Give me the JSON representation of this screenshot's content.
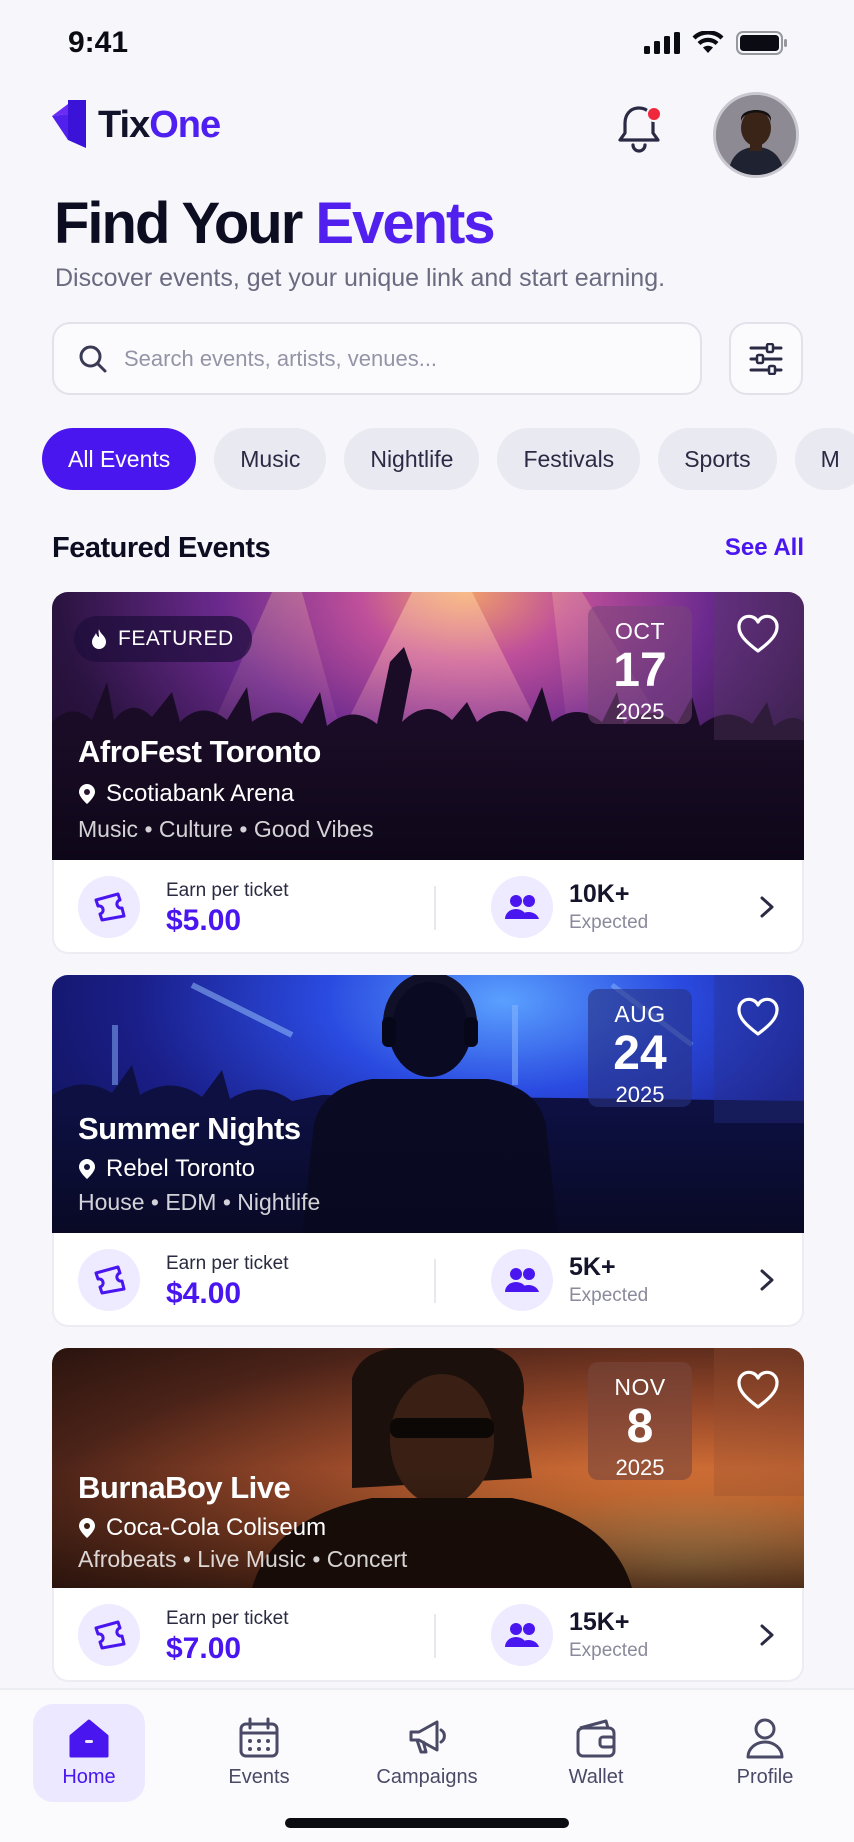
{
  "status_bar": {
    "time": "9:41"
  },
  "header": {
    "logo_part1": "Tix",
    "logo_part2": "One",
    "notification_icon": "bell-icon",
    "has_notification": true
  },
  "hero": {
    "title_part1": "Find Your ",
    "title_part2": "Events",
    "subtitle": "Discover events, get your unique link and start earning."
  },
  "search": {
    "placeholder": "Search events, artists, venues..."
  },
  "categories": [
    {
      "label": "All Events",
      "active": true
    },
    {
      "label": "Music",
      "active": false
    },
    {
      "label": "Nightlife",
      "active": false
    },
    {
      "label": "Festivals",
      "active": false
    },
    {
      "label": "Sports",
      "active": false
    },
    {
      "label": "M",
      "active": false
    }
  ],
  "featured": {
    "title": "Featured Events",
    "see_all": "See All",
    "earn_label": "Earn per ticket",
    "expected_label": "Expected",
    "badge": "FEATURED",
    "events": [
      {
        "name": "AfroFest Toronto",
        "venue": "Scotiabank Arena",
        "tags": "Music • Culture • Good Vibes",
        "month": "OCT",
        "day": "17",
        "year": "2025",
        "earn": "$5.00",
        "expected": "10K+",
        "featured": true
      },
      {
        "name": "Summer Nights",
        "venue": "Rebel Toronto",
        "tags": "House • EDM • Nightlife",
        "month": "AUG",
        "day": "24",
        "year": "2025",
        "earn": "$4.00",
        "expected": "5K+",
        "featured": false
      },
      {
        "name": "BurnaBoy Live",
        "venue": "Coca-Cola Coliseum",
        "tags": "Afrobeats • Live Music • Concert",
        "month": "NOV",
        "day": "8",
        "year": "2025",
        "earn": "$7.00",
        "expected": "15K+",
        "featured": false
      }
    ]
  },
  "tabbar": [
    {
      "label": "Home",
      "icon": "home-icon",
      "active": true
    },
    {
      "label": "Events",
      "icon": "calendar-icon",
      "active": false
    },
    {
      "label": "Campaigns",
      "icon": "megaphone-icon",
      "active": false
    },
    {
      "label": "Wallet",
      "icon": "wallet-icon",
      "active": false
    },
    {
      "label": "Profile",
      "icon": "user-icon",
      "active": false
    }
  ],
  "colors": {
    "accent": "#4a16f0",
    "background": "#f6f6fb",
    "notification_dot": "#f0283c"
  }
}
